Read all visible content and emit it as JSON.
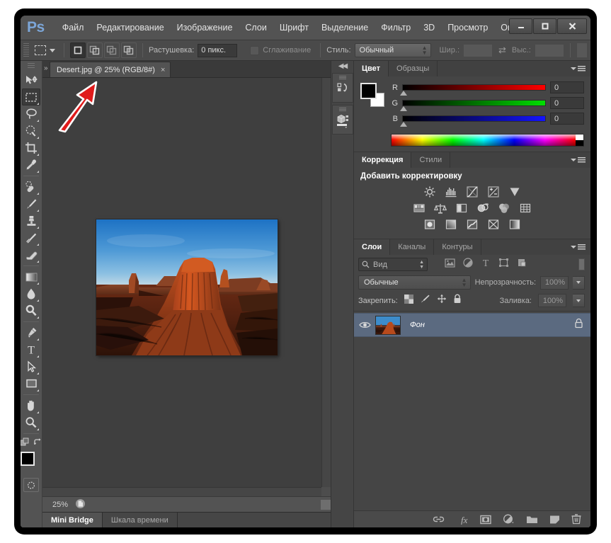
{
  "app": {
    "logo": "Ps",
    "menu": [
      "Файл",
      "Редактирование",
      "Изображение",
      "Слои",
      "Шрифт",
      "Выделение",
      "Фильтр",
      "3D",
      "Просмотр",
      "Окно"
    ],
    "window_buttons": [
      "minimize-button",
      "maximize-button",
      "close-button"
    ]
  },
  "options_bar": {
    "tool_preset_icon": "rectangular-marquee-icon",
    "selection_modes": [
      "new-selection",
      "add-to-selection",
      "subtract-from-selection",
      "intersect-selection"
    ],
    "active_selection_mode": 0,
    "feather_label": "Растушевка:",
    "feather_value": "0 пикс.",
    "antialias_label": "Сглаживание",
    "antialias_checked": false,
    "style_label": "Стиль:",
    "style_value": "Обычный",
    "width_label": "Шир.:",
    "width_value": "",
    "height_label": "Выс.:",
    "height_value": "",
    "swap_icon": "swap-dimensions-icon"
  },
  "toolbar": {
    "tools": [
      {
        "name": "move-tool",
        "has_corner": false
      },
      {
        "name": "rectangular-marquee-tool",
        "has_corner": true,
        "active": true
      },
      {
        "name": "lasso-tool",
        "has_corner": true
      },
      {
        "name": "quick-selection-tool",
        "has_corner": true
      },
      {
        "name": "crop-tool",
        "has_corner": true
      },
      {
        "name": "eyedropper-tool",
        "has_corner": true
      },
      {
        "name": "spot-healing-brush-tool",
        "has_corner": true
      },
      {
        "name": "brush-tool",
        "has_corner": true
      },
      {
        "name": "clone-stamp-tool",
        "has_corner": true
      },
      {
        "name": "history-brush-tool",
        "has_corner": true
      },
      {
        "name": "eraser-tool",
        "has_corner": true
      },
      {
        "name": "gradient-tool",
        "has_corner": true
      },
      {
        "name": "blur-tool",
        "has_corner": true
      },
      {
        "name": "dodge-tool",
        "has_corner": true
      },
      {
        "name": "pen-tool",
        "has_corner": true
      },
      {
        "name": "horizontal-type-tool",
        "has_corner": true
      },
      {
        "name": "path-selection-tool",
        "has_corner": true
      },
      {
        "name": "rectangle-tool",
        "has_corner": true
      },
      {
        "name": "hand-tool",
        "has_corner": true
      },
      {
        "name": "zoom-tool",
        "has_corner": true
      }
    ],
    "foreground_color": "#000000",
    "background_color": "#ffffff",
    "quick_mask_label": "quick-mask-mode"
  },
  "document": {
    "tab_title": "Desert.jpg @ 25% (RGB/8#)",
    "close_label": "×",
    "zoom_level": "25%",
    "status_icon": "document-info-icon"
  },
  "bottom_tabs": {
    "tabs": [
      {
        "label": "Mini Bridge",
        "active": true
      },
      {
        "label": "Шкала времени",
        "active": false
      }
    ]
  },
  "mini_dock": {
    "items": [
      "history-actions-panel-icon",
      "3d-properties-panel-icon"
    ],
    "collapse_icon": "collapse-panels-icon"
  },
  "color_panel": {
    "tabs": [
      {
        "label": "Цвет",
        "active": true
      },
      {
        "label": "Образцы",
        "active": false
      }
    ],
    "sliders": [
      {
        "label": "R",
        "value": "0"
      },
      {
        "label": "G",
        "value": "0"
      },
      {
        "label": "B",
        "value": "0"
      }
    ],
    "foreground_color": "#000000",
    "background_color": "#ffffff"
  },
  "adjustments_panel": {
    "tabs": [
      {
        "label": "Коррекция",
        "active": true
      },
      {
        "label": "Стили",
        "active": false
      }
    ],
    "title": "Добавить корректировку",
    "icon_rows": [
      [
        "brightness-contrast-icon",
        "levels-icon",
        "curves-icon",
        "exposure-icon",
        "vibrance-icon"
      ],
      [
        "hue-saturation-icon",
        "color-balance-icon",
        "black-white-icon",
        "photo-filter-icon",
        "channel-mixer-icon",
        "color-lookup-icon"
      ],
      [
        "invert-icon",
        "posterize-icon",
        "threshold-icon",
        "selective-color-icon",
        "gradient-map-icon"
      ]
    ]
  },
  "layers_panel": {
    "tabs": [
      {
        "label": "Слои",
        "active": true
      },
      {
        "label": "Каналы",
        "active": false
      },
      {
        "label": "Контуры",
        "active": false
      }
    ],
    "filter_label": "Вид",
    "filter_icons": [
      "filter-pixel-icon",
      "filter-adjustment-icon",
      "filter-type-icon",
      "filter-shape-icon",
      "filter-smart-object-icon"
    ],
    "blend_mode": "Обычные",
    "opacity_label": "Непрозрачность:",
    "opacity_value": "100%",
    "lock_label": "Закрепить:",
    "lock_icons": [
      "lock-transparent-pixels-icon",
      "lock-image-pixels-icon",
      "lock-position-icon",
      "lock-all-icon"
    ],
    "fill_label": "Заливка:",
    "fill_value": "100%",
    "layers": [
      {
        "name": "Фон",
        "visible": true,
        "locked": true,
        "selected": true
      }
    ],
    "footer_icons": [
      "link-layers-icon",
      "layer-style-fx-icon",
      "add-layer-mask-icon",
      "new-adjustment-layer-icon",
      "new-group-icon",
      "new-layer-icon",
      "delete-layer-icon"
    ]
  },
  "annotation": {
    "type": "red-arrow",
    "color": "#e01b1b",
    "points_to": "document-tab"
  },
  "colors": {
    "window_chrome": "#535353",
    "panel_bg": "#454545",
    "canvas_bg": "#3f3f3f",
    "tab_active": "#535353",
    "selection_blue": "#5b6a80",
    "logo_blue": "#7ca6d8",
    "accent_red": "#e01b1b"
  }
}
